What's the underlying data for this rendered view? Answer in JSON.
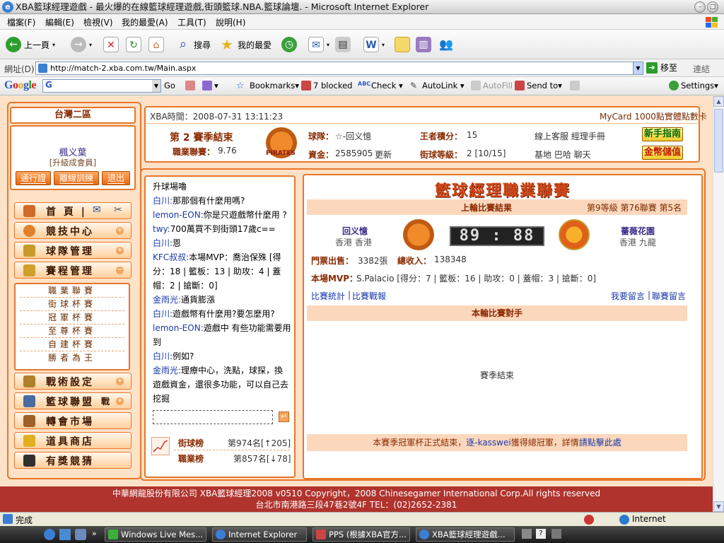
{
  "window": {
    "title": "XBA籃球經理遊戲 - 最火爆的在線籃球經理遊戲,街頭籃球.NBA.籃球論壇. - Microsoft Internet Explorer"
  },
  "menu": [
    "檔案(F)",
    "編輯(E)",
    "檢視(V)",
    "我的最愛(A)",
    "工具(T)",
    "說明(H)"
  ],
  "toolbar": {
    "back": "上一頁",
    "search": "搜尋",
    "favorites": "我的最愛"
  },
  "address": {
    "label": "網址(D)",
    "url": "http://match-2.xba.com.tw/Main.aspx",
    "go": "移至",
    "links": "連結"
  },
  "googlebar": {
    "logo": "Google",
    "go": "Go",
    "bookmarks": "Bookmarks▾",
    "blocked": "7 blocked",
    "check": "Check",
    "autolink": "AutoLink",
    "autofill": "AutoFill",
    "sendto": "Send to▾",
    "settings": "Settings▾"
  },
  "left": {
    "region": "台灣二區",
    "user_name": "楓义葉",
    "user_level": "[升級成會員]",
    "btns": [
      "通行證",
      "離線訓練",
      "退出"
    ],
    "nav": [
      {
        "label": "首 頁 |",
        "icon": "home-icon",
        "color": "#d06a2a"
      },
      {
        "label": "競技中心",
        "icon": "basketball-icon",
        "color": "#e0802a"
      },
      {
        "label": "球隊管理",
        "icon": "clipboard-icon",
        "color": "#c89a2a"
      },
      {
        "label": "賽程管理",
        "icon": "trophy-icon",
        "color": "#d0a02a"
      }
    ],
    "sub": [
      "職業聯賽",
      "街球杯賽",
      "冠軍杯賽",
      "至尊杯賽",
      "自建杯賽",
      "勝者為王"
    ],
    "nav2": [
      {
        "label": "戰術設定",
        "icon": "tactics-icon",
        "color": "#b0802a"
      },
      {
        "label": "籃球聯盟",
        "icon": "league-icon",
        "color": "#4a6aa0",
        "extra": "戰"
      },
      {
        "label": "轉會市場",
        "icon": "hammer-icon",
        "color": "#a0602a"
      },
      {
        "label": "道具商店",
        "icon": "gold-icon",
        "color": "#e0b020"
      },
      {
        "label": "有獎競猜",
        "icon": "spade-icon",
        "color": "#303030"
      }
    ]
  },
  "info": {
    "time": "XBA時間：2008-07-31 13:11:23",
    "ticker": "MyCard 1000點實體點數卡",
    "season": "第 2 賽季結束",
    "league_label": "職業聯賽：",
    "league_val": "9.76",
    "team_label": "球隊：",
    "team_val": "☆-回义憶",
    "king_label": "王者積分：",
    "king_val": "15",
    "service": "線上客服 經理手冊",
    "newbie": "新手指南",
    "fund_label": "資金：",
    "fund_val": "2585905",
    "refresh": "更新",
    "street_label": "街球等級：",
    "street_val": "2 [10/15]",
    "links": "基地 巴哈 聊天",
    "deposit": "金幣儲值",
    "team_logo_text": "PIRATES"
  },
  "chat": {
    "messages": [
      {
        "who": "",
        "text": "升球場嚕"
      },
      {
        "who": "白川:",
        "text": "那那個有什麼用嗎?"
      },
      {
        "who": "lemon-EON:",
        "text": "你是只遊戲幣什麼用 ?"
      },
      {
        "who": "twy:",
        "text": "700萬買不到街頭17歲c=="
      },
      {
        "who": "白川:",
        "text": "恩"
      },
      {
        "who": "KFC叔叔:",
        "text": "本場MVP：喬治保殊 [得分：18 | 籃板：13 | 助攻：4 | 蓋帽：2 | 搶斷：0]"
      },
      {
        "who": "金雨光:",
        "text": "通貨膨漲"
      },
      {
        "who": "白川:",
        "text": "遊戲幣有什麼用?要怎麼用?"
      },
      {
        "who": "lemon-EON:",
        "text": "遊戲中 有些功能需要用到"
      },
      {
        "who": "白川:",
        "text": "例如?"
      },
      {
        "who": "金雨光:",
        "text": "理療中心，洗點，球探，換遊戲資金，還很多功能，可以自己去挖掘"
      }
    ],
    "street_rank_label": "街球榜",
    "street_rank": "第974名[↑205]",
    "pro_rank_label": "職業榜",
    "pro_rank": "第857名[↓78]"
  },
  "main": {
    "banner": "籃球經理職業聯賽",
    "last_result": "上輪比賽結果",
    "league_info": "第9等級  第76聯賽  第5名",
    "home_name": "回义憶",
    "home_loc": "香港  香港",
    "score": "89 : 88",
    "away_name": "薔薇花園",
    "away_loc": "香港  九龍",
    "ticket_label": "門票出售：",
    "ticket_val": "3382張",
    "income_label": "總收入：",
    "income_val": "138348",
    "mvp_label": "本場MVP：",
    "mvp_val": "S.Palacio  [得分：7 | 籃板：16 | 助攻：0 | 蓋帽：3 | 搶斷：0]",
    "link_stats": "比賽統計",
    "link_sep": "|",
    "link_watch": "比賽戰報",
    "link_msg": "我要留言",
    "link_league_msg": "聯賽留言",
    "opponent_title": "本輪比賽對手",
    "season_end": "賽季結束",
    "notice_pre": "本賽季冠軍杯正式結束，",
    "notice_team": "逐-kasswei",
    "notice_mid": "獲得總冠軍，詳情",
    "notice_link": "請點擊此處"
  },
  "footer": {
    "line1": "中華網龍股份有限公司  XBA籃球經理2008 v0510     Copyright，2008 Chinesegamer International Corp.All rights reserved",
    "line2": "台北市南港路三段47巷2號4F TEL：(02)2652-2381"
  },
  "status": {
    "text": "完成",
    "zone": "Internet"
  },
  "taskbar": [
    "Windows Live Mes...",
    "Internet Explorer",
    "PPS (根據XBA官方...",
    "XBA籃球經理遊戲..."
  ]
}
